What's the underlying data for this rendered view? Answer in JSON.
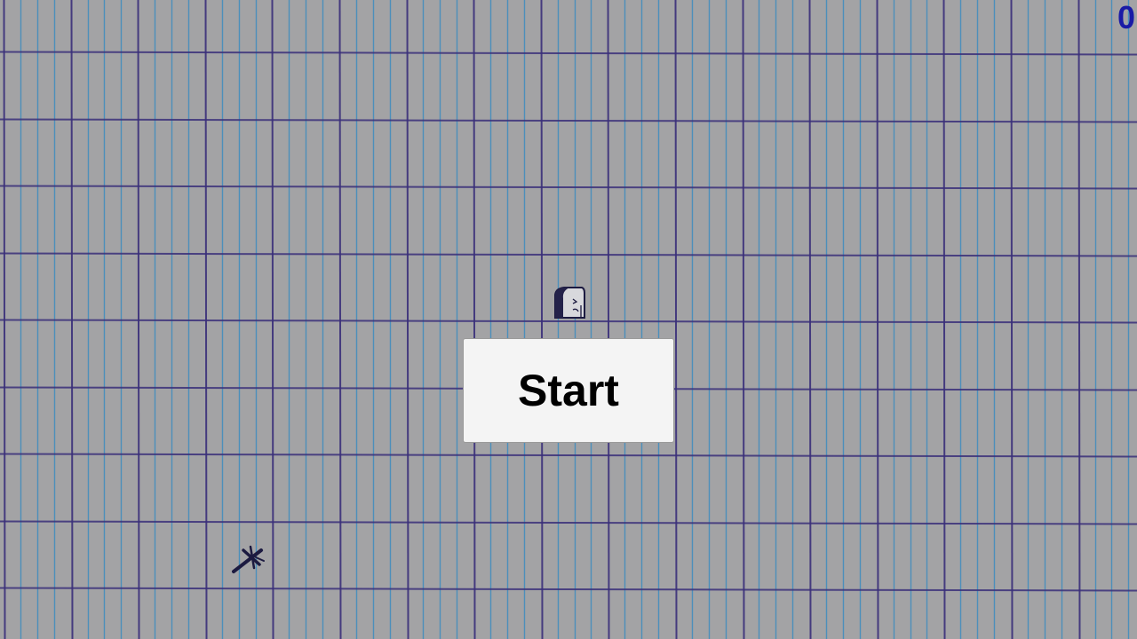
{
  "hud": {
    "score": "0"
  },
  "menu": {
    "start_label": "Start"
  },
  "sprites": {
    "player": "doodle-character-icon",
    "enemy": "doodle-plane-icon"
  },
  "colors": {
    "paper": "#a3a3a5",
    "light_grid_line": "#3d8cbf",
    "dark_grid_line": "#3a2f7a",
    "score_text": "#1a1aa6",
    "button_bg": "#f4f4f4"
  }
}
